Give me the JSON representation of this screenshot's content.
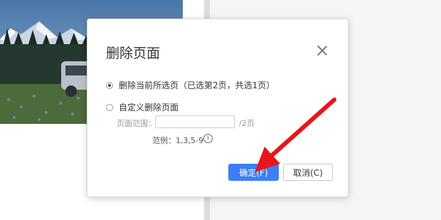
{
  "dialog": {
    "title": "删除页面",
    "option_current": "删除当前所选页（已选第2页，共选1页）",
    "option_custom": "自定义删除页面",
    "range_label": "页面范围：",
    "range_value": "",
    "range_suffix": "/2页",
    "example_text": "范例：1,3,5-9",
    "info_icon_glyph": "i",
    "ok_label": "确定(F)",
    "cancel_label": "取消(C)",
    "selected_option": "current"
  },
  "colors": {
    "primary": "#3d7ef5",
    "arrow": "#e8161b"
  }
}
